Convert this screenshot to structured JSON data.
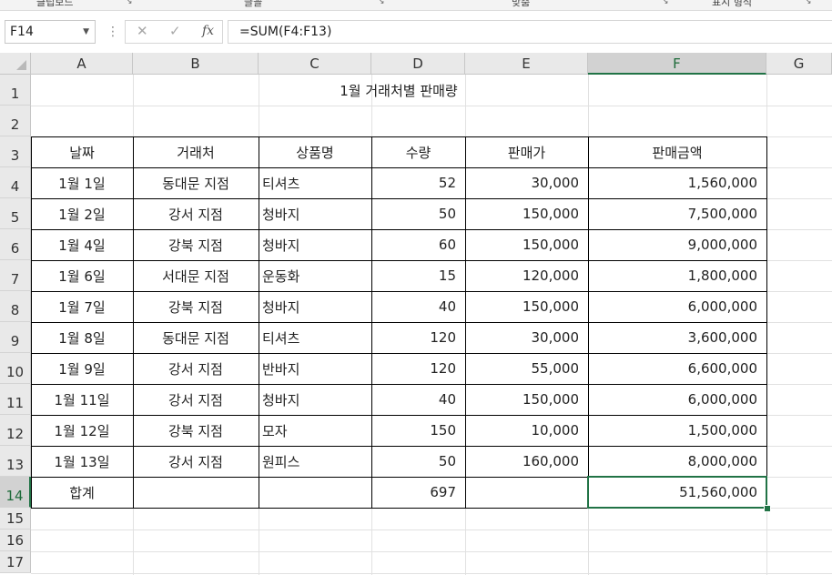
{
  "ribbon": {
    "groups": [
      "클립보드",
      "글꼴",
      "맞춤",
      "표시 형식"
    ]
  },
  "formula_bar": {
    "name_box": "F14",
    "formula": "=SUM(F4:F13)"
  },
  "columns": [
    "A",
    "B",
    "C",
    "D",
    "E",
    "F",
    "G"
  ],
  "rows": [
    "1",
    "2",
    "3",
    "4",
    "5",
    "6",
    "7",
    "8",
    "9",
    "10",
    "11",
    "12",
    "13",
    "14",
    "15",
    "16",
    "17"
  ],
  "selected_cell": "F14",
  "sheet": {
    "title": "1월 거래처별 판매량",
    "headers": [
      "날짜",
      "거래처",
      "상품명",
      "수량",
      "판매가",
      "판매금액"
    ],
    "data": [
      [
        "1월 1일",
        "동대문 지점",
        "티셔츠",
        "52",
        "30,000",
        "1,560,000"
      ],
      [
        "1월 2일",
        "강서 지점",
        "청바지",
        "50",
        "150,000",
        "7,500,000"
      ],
      [
        "1월 4일",
        "강북 지점",
        "청바지",
        "60",
        "150,000",
        "9,000,000"
      ],
      [
        "1월 6일",
        "서대문 지점",
        "운동화",
        "15",
        "120,000",
        "1,800,000"
      ],
      [
        "1월 7일",
        "강북 지점",
        "청바지",
        "40",
        "150,000",
        "6,000,000"
      ],
      [
        "1월 8일",
        "동대문 지점",
        "티셔츠",
        "120",
        "30,000",
        "3,600,000"
      ],
      [
        "1월 9일",
        "강서 지점",
        "반바지",
        "120",
        "55,000",
        "6,600,000"
      ],
      [
        "1월 11일",
        "강서  지점",
        "청바지",
        "40",
        "150,000",
        "6,000,000"
      ],
      [
        "1월 12일",
        "강북 지점",
        "모자",
        "150",
        "10,000",
        "1,500,000"
      ],
      [
        "1월 13일",
        "강서 지점",
        "원피스",
        "50",
        "160,000",
        "8,000,000"
      ]
    ],
    "total": [
      "합계",
      "",
      "",
      "697",
      "",
      "51,560,000"
    ]
  },
  "colors": {
    "selection": "#217346",
    "header_bg": "#e9e9e9",
    "gridline": "#e1e1e1"
  },
  "icons": [
    "dropdown-arrow-icon",
    "cancel-icon",
    "enter-icon",
    "insert-function-icon",
    "dialog-launcher-icon"
  ]
}
